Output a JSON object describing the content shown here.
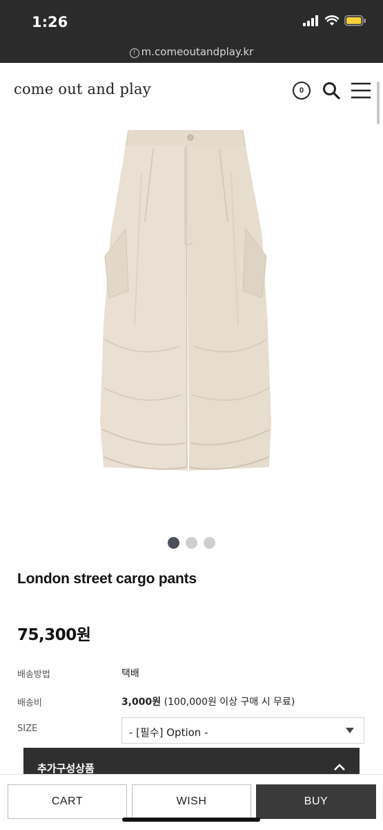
{
  "status_bar": {
    "time": "1:26",
    "url": "m.comeoutandplay.kr"
  },
  "header": {
    "logo": "come out and play",
    "cart_count": "0"
  },
  "product": {
    "name": "London street cargo pants",
    "price": "75,300원",
    "image_count": 3,
    "active_image": 1
  },
  "info": {
    "shipping_method_label": "배송방법",
    "shipping_method_value": "택배",
    "shipping_fee_label": "배송비",
    "shipping_fee_value": "3,000원",
    "shipping_fee_note": " (100,000원 이상 구매 시 무료)",
    "size_label": "SIZE",
    "size_option": "- [필수] Option -"
  },
  "addon": {
    "label": "추가구성상품"
  },
  "actions": {
    "cart": "CART",
    "wish": "WISH",
    "buy": "BUY"
  },
  "colors": {
    "status_bar": "#2b2b2b",
    "buy_button": "#3a3a3a",
    "pants": "#e8dfd2"
  }
}
